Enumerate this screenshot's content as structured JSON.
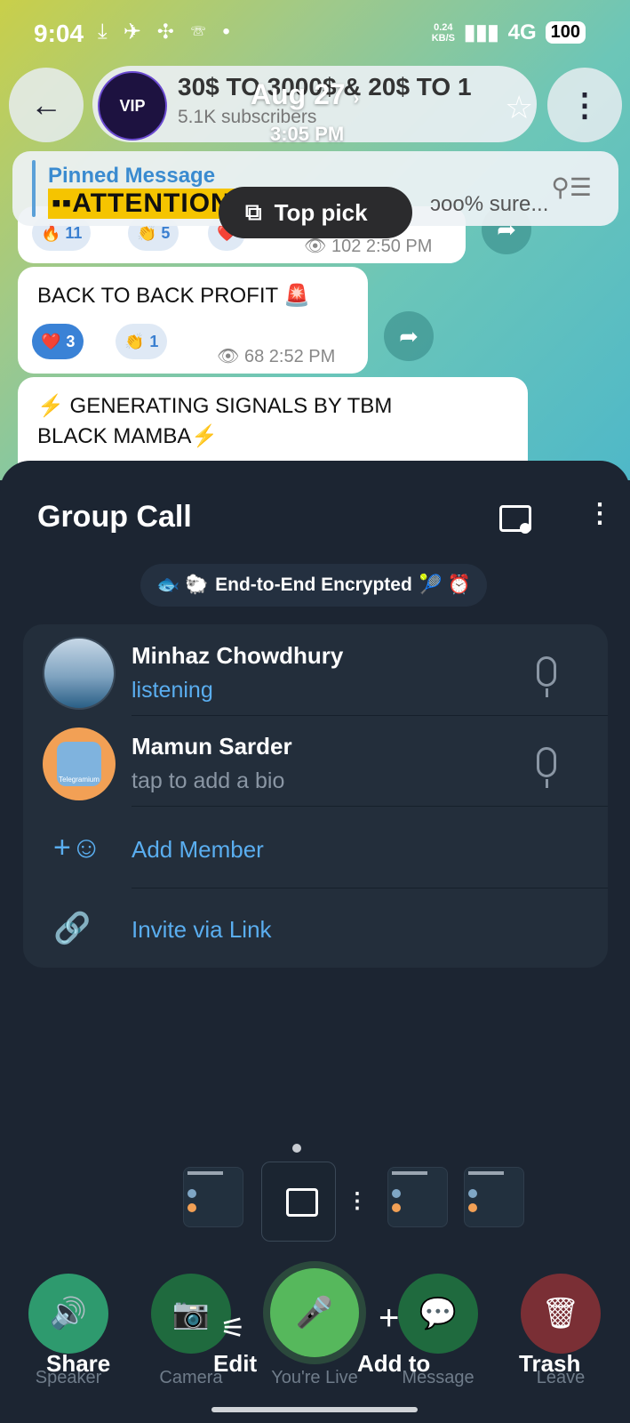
{
  "status_bar": {
    "time": "9:04",
    "left_icons": "⤓ ✈ ✣ ☏ •",
    "net_speed_value": "0.24",
    "net_speed_unit": "KB/S",
    "signal": "▮▮▮",
    "network": "4G",
    "battery": "100"
  },
  "chat_header": {
    "title": "30$ TO 3000$ & 20$ TO 1",
    "subscribers": "5.1K subscribers",
    "date": "Aug 27",
    "date_chevron": "›",
    "time": "3:05 PM",
    "avatar_text": "VIP"
  },
  "pinned": {
    "title": "Pinned Message",
    "text": "▪▪ATTENTION",
    "tail": "ɔoo% sure..."
  },
  "top_pick": {
    "label": "Top pick"
  },
  "messages": [
    {
      "views": "102",
      "time": "2:50 PM",
      "reactions": [
        "🔥 11",
        "👏 5",
        "❤️"
      ]
    },
    {
      "text": "BACK TO BACK PROFIT 🚨",
      "views": "68",
      "time": "2:52 PM",
      "reactions": [
        {
          "emoji": "❤️",
          "count": "3"
        },
        {
          "emoji": "👏",
          "count": "1"
        }
      ]
    },
    {
      "text_line1": "⚡ GENERATING SIGNALS BY TBM",
      "text_line2": "BLACK MAMBA⚡"
    }
  ],
  "group_call": {
    "title": "Group Call",
    "encrypted_label": "End-to-End Encrypted",
    "encrypted_emojis_left": "🐟 🐑",
    "encrypted_emojis_right": "🎾 ⏰",
    "participants": [
      {
        "name": "Minhaz Chowdhury",
        "status": "listening",
        "status_color": "#5aaef0"
      },
      {
        "name": "Mamun Sarder",
        "status": "tap to add a bio",
        "status_color": "#8a96a4",
        "avatar_label": "Telegramium"
      }
    ],
    "actions": [
      {
        "label": "Add Member",
        "icon": "add-user-icon"
      },
      {
        "label": "Invite via Link",
        "icon": "link-icon"
      }
    ]
  },
  "controls": [
    {
      "label": "Speaker",
      "color": "#2e9a6e",
      "icon": "speaker-icon"
    },
    {
      "label": "Camera",
      "color": "#1f6a3e",
      "icon": "camera-off-icon"
    },
    {
      "label": "You're Live",
      "color": "#56b85c",
      "icon": "mic-icon"
    },
    {
      "label": "Message",
      "color": "#1f6a3e",
      "icon": "message-icon"
    },
    {
      "label": "Leave",
      "color": "#7a2f35",
      "icon": "leave-icon"
    }
  ],
  "overlay_actions": {
    "share": "Share",
    "edit": "Edit",
    "add_to": "Add to",
    "trash": "Trash"
  },
  "colors": {
    "accent": "#5aaef0",
    "sheet_bg": "#1c2532",
    "panel_bg": "#232e3b"
  }
}
